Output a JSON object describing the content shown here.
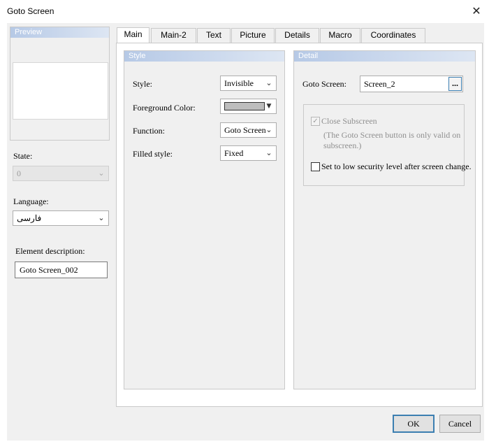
{
  "window": {
    "title": "Goto Screen",
    "close_glyph": "✕"
  },
  "left_panel": {
    "preview_label": "Preview",
    "state_label": "State:",
    "state_value": "0",
    "language_label": "Language:",
    "language_value": "فارسی",
    "element_description_label": "Element description:",
    "element_description_value": "Goto Screen_002"
  },
  "tabs": [
    {
      "label": "Main"
    },
    {
      "label": "Main-2"
    },
    {
      "label": "Text"
    },
    {
      "label": "Picture"
    },
    {
      "label": "Details"
    },
    {
      "label": "Macro"
    },
    {
      "label": "Coordinates"
    }
  ],
  "style_group": {
    "header": "Style",
    "style_label": "Style:",
    "style_value": "Invisible",
    "foreground_label": "Foreground Color:",
    "foreground_color": "#bdbdbd",
    "function_label": "Function:",
    "function_value": "Goto Screen",
    "filled_label": "Filled style:",
    "filled_value": "Fixed"
  },
  "detail_group": {
    "header": "Detail",
    "goto_label": "Goto Screen:",
    "goto_value": "Screen_2",
    "browse_label": "...",
    "close_subscreen_label": "Close Subscreen",
    "close_subscreen_checked": true,
    "note": "(The Goto Screen button is only valid on subscreen.)",
    "low_security_label": "Set to low security level after screen change.",
    "low_security_checked": false
  },
  "footer": {
    "ok_label": "OK",
    "cancel_label": "Cancel"
  },
  "icons": {
    "dropdown": "chevron-down-icon",
    "close": "close-icon",
    "check": "check-icon"
  },
  "colors": {
    "header_gradient_start": "#b6c9e6",
    "header_gradient_end": "#dde6f3",
    "default_button_border": "#3c7fb1"
  }
}
